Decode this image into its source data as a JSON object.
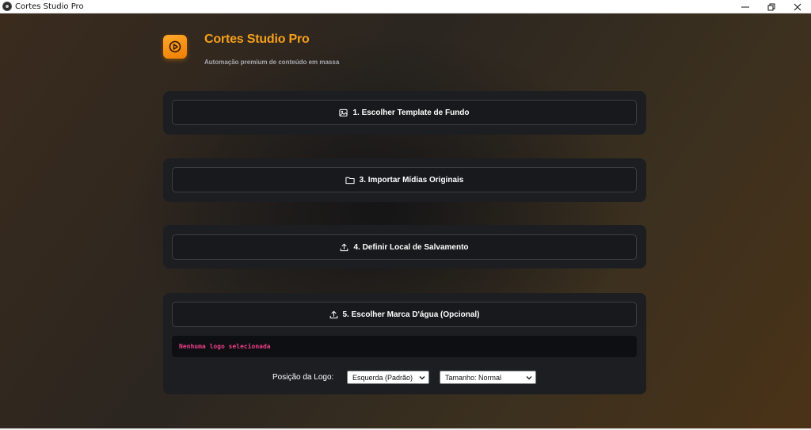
{
  "window": {
    "title": "Cortes Studio Pro",
    "controls": [
      "minimize-icon",
      "restore-icon",
      "close-icon"
    ]
  },
  "header": {
    "app_name": "Cortes Studio Pro",
    "tagline": "Automação premium de conteúdo em massa",
    "logo_icon": "play-circle-icon"
  },
  "steps": [
    {
      "label": "1. Escolher Template de Fundo",
      "icon": "image-icon"
    },
    {
      "label": "3. Importar Mídias Originais",
      "icon": "folder-icon"
    },
    {
      "label": "4. Definir Local de Salvamento",
      "icon": "upload-icon"
    },
    {
      "label": "5. Escolher Marca D'água (Opcional)",
      "icon": "upload-icon"
    }
  ],
  "watermark": {
    "status": "Nenhuma logo selecionada",
    "position_label": "Posição da Logo:",
    "position_value": "Esquerda (Padrão)",
    "size_value": "Tamanho: Normal"
  },
  "colors": {
    "accent": "#f7a01a",
    "status_text": "#ec3f8a",
    "card_bg": "#1c1e22"
  }
}
